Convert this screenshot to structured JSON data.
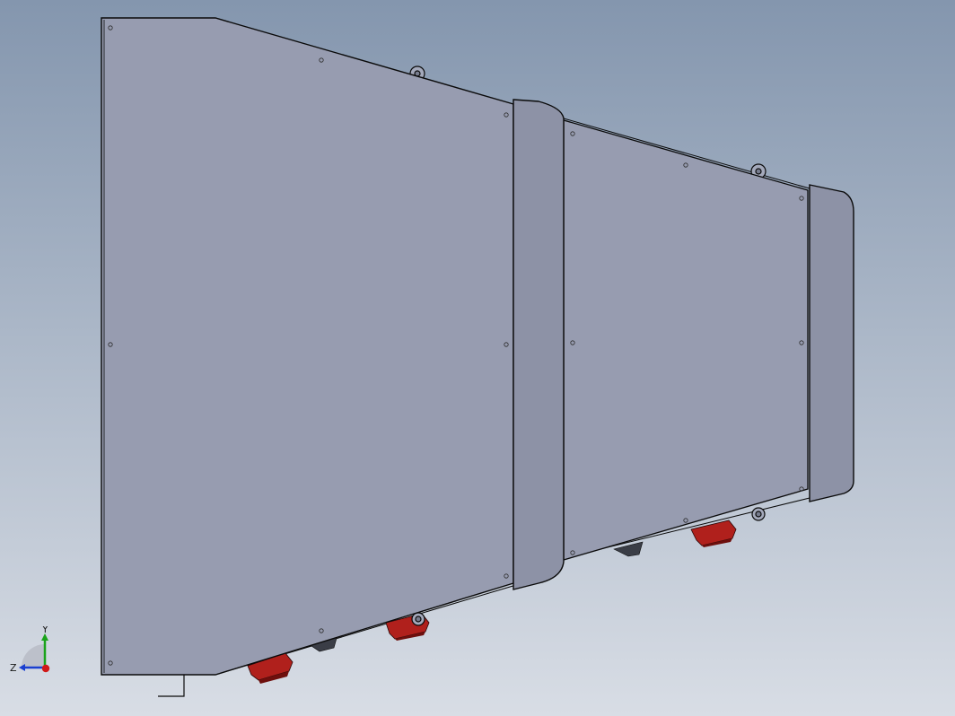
{
  "viewport": {
    "background_top": "#8496ae",
    "background_bottom": "#d8dde5"
  },
  "model": {
    "panel_fill": "#979cb0",
    "panel_fill_dark": "#8d92a6",
    "edge_color": "#0a0a0a",
    "foot_color": "#b0201c",
    "foot_shadow": "#6e0f0d"
  },
  "triad": {
    "y_label": "Y",
    "z_label": "Z",
    "y_color": "#1aa31a",
    "x_color": "#d01818",
    "z_color": "#1a3fd0"
  }
}
